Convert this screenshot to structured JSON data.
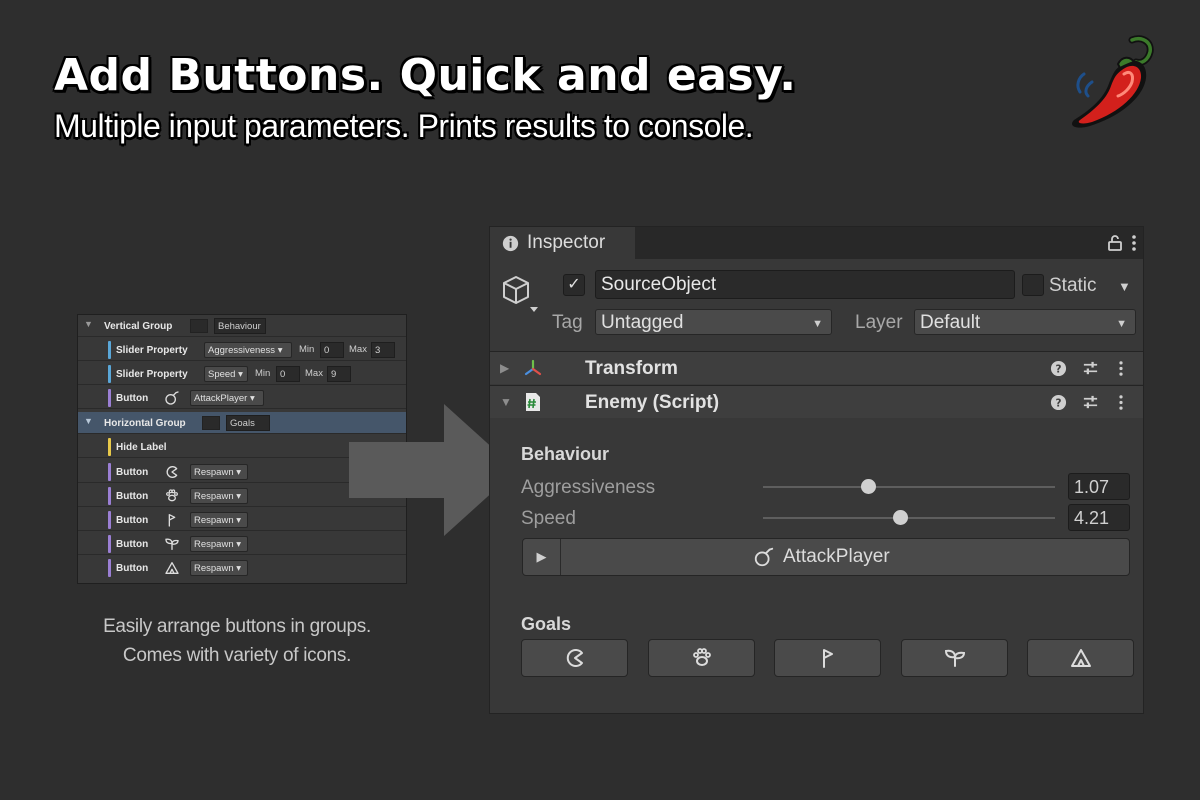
{
  "hero": {
    "title": "Add Buttons. Quick and easy.",
    "subtitle": "Multiple input parameters. Prints results to console."
  },
  "logo": {
    "icon": "chili-pepper-icon",
    "accent": "#d3201c"
  },
  "mini_panel": {
    "rows": [
      {
        "label": "Vertical Group",
        "field": "Behaviour",
        "bar_color": ""
      },
      {
        "label": "Slider Property",
        "drop": "Aggressiveness",
        "min_label": "Min",
        "min": "0",
        "max_label": "Max",
        "max": "3",
        "bar_color": "#5aa7d8"
      },
      {
        "label": "Slider Property",
        "drop": "Speed",
        "min_label": "Min",
        "min": "0",
        "max_label": "Max",
        "max": "9",
        "bar_color": "#5aa7d8"
      },
      {
        "label": "Button",
        "drop": "AttackPlayer",
        "icon": "bomb-icon",
        "bar_color": "#9b7fd4"
      },
      {
        "label": "Horizontal Group",
        "field": "Goals",
        "bar_color": ""
      },
      {
        "label": "Hide Label",
        "bar_color": "#e8c94a"
      },
      {
        "label": "Button",
        "drop": "Respawn",
        "icon": "pacman-icon",
        "bar_color": "#9b7fd4"
      },
      {
        "label": "Button",
        "drop": "Respawn",
        "icon": "paw-icon",
        "bar_color": "#9b7fd4"
      },
      {
        "label": "Button",
        "drop": "Respawn",
        "icon": "flag-icon",
        "bar_color": "#9b7fd4"
      },
      {
        "label": "Button",
        "drop": "Respawn",
        "icon": "sprout-icon",
        "bar_color": "#9b7fd4"
      },
      {
        "label": "Button",
        "drop": "Respawn",
        "icon": "tent-icon",
        "bar_color": "#9b7fd4"
      }
    ]
  },
  "caption": {
    "line1": "Easily arrange buttons in groups.",
    "line2": "Comes with variety of icons."
  },
  "inspector": {
    "tab_label": "Inspector",
    "object_name": "SourceObject",
    "active_checked": true,
    "static_label": "Static",
    "tag_label": "Tag",
    "tag_value": "Untagged",
    "layer_label": "Layer",
    "layer_value": "Default",
    "components": [
      {
        "title": "Transform",
        "icon": "transform-axes-icon",
        "expanded": false
      },
      {
        "title": "Enemy (Script)",
        "icon": "script-icon",
        "expanded": true
      }
    ],
    "behaviour": {
      "title": "Behaviour",
      "sliders": [
        {
          "label": "Aggressiveness",
          "value": "1.07",
          "min": 0,
          "max": 3,
          "fraction": 0.36
        },
        {
          "label": "Speed",
          "value": "4.21",
          "min": 0,
          "max": 9,
          "fraction": 0.47
        }
      ],
      "button_label": "AttackPlayer",
      "button_icon": "bomb-icon"
    },
    "goals": {
      "title": "Goals",
      "buttons": [
        "pacman-icon",
        "paw-icon",
        "flag-icon",
        "sprout-icon",
        "tent-icon"
      ]
    }
  }
}
